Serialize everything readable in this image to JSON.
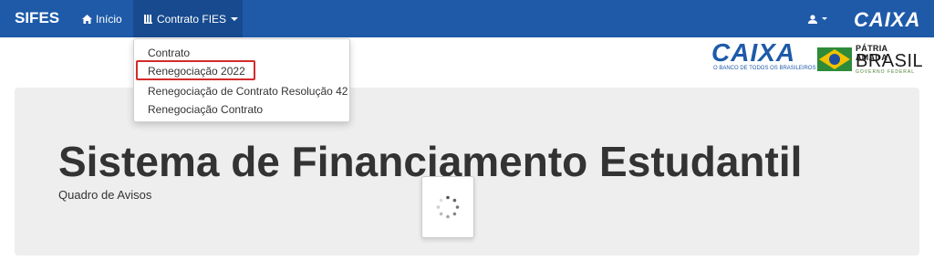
{
  "navbar": {
    "brand": "SIFES",
    "home_label": "Início",
    "contrato_label": "Contrato FIES",
    "caixa_logo": "CAIXA",
    "colors": {
      "bar": "#1e5aa8",
      "active": "#174a8f"
    }
  },
  "dropdown": {
    "items": [
      {
        "label": "Contrato"
      },
      {
        "label": "Renegociação 2022"
      },
      {
        "label": "Renegociação de Contrato Resolução 42"
      },
      {
        "label": "Renegociação Contrato"
      }
    ],
    "highlight_color": "#d42b2b"
  },
  "logos": {
    "caixa": {
      "word": "CAIXA",
      "tagline": "O BANCO DE TODOS OS BRASILEIROS"
    },
    "brasil": {
      "line1": "PÁTRIA AMADA",
      "line2": "BRASIL",
      "line3": "GOVERNO FEDERAL"
    }
  },
  "jumbotron": {
    "title": "Sistema de Financiamento Estudantil",
    "subtitle": "Quadro de Avisos"
  },
  "icons": {
    "home": "home-icon",
    "contrato": "book-icon",
    "user": "user-icon",
    "loader": "spinner-icon"
  }
}
